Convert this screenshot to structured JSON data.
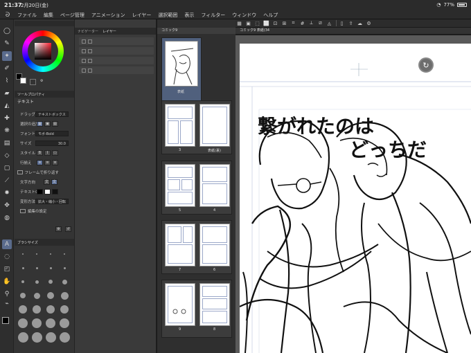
{
  "status": {
    "time": "21:37",
    "date": "2月20日(金)",
    "battery": "77%"
  },
  "menu": [
    "ファイル",
    "編集",
    "ページ管理",
    "アニメーション",
    "レイヤー",
    "選択範囲",
    "表示",
    "フィルター",
    "ウィンドウ",
    "ヘルプ"
  ],
  "left": {
    "tool_property_tab": "ツールプロパティ",
    "subtool_title": "テキスト",
    "props": [
      {
        "label": "ドラッグ",
        "value": "テキストボックス"
      },
      {
        "label": "選択の追加",
        "value": ""
      },
      {
        "label": "フォント",
        "value": "モボ-Bold"
      },
      {
        "label": "サイズ",
        "value": "30.0"
      },
      {
        "label": "スタイル",
        "value": "B  I"
      },
      {
        "label": "行揃え",
        "value": ""
      },
      {
        "label": "文字方向",
        "value": ""
      },
      {
        "label": "テキストの色",
        "value": ""
      },
      {
        "label": "変形方法",
        "value": "拡大・縮小・回転"
      }
    ],
    "frame_wrap_label": "フレームで折り返す",
    "edit_tools_label": "編集の設定",
    "brush_size_tab": "ブラシサイズ",
    "color": {
      "main": "#000000",
      "sub": "#ffffff",
      "hue": "#ff2030"
    }
  },
  "layers": {
    "tabs": [
      "ナビゲーター",
      "レイヤー"
    ]
  },
  "pages": {
    "tab": "コミック9",
    "labels": [
      "表紙",
      "3",
      "表紙(裏)",
      "5",
      "4",
      "7",
      "6",
      "9",
      "8"
    ]
  },
  "canvas": {
    "tabs": [
      "コミック9 表紙(34"
    ],
    "title_line1": "繋がれたのは",
    "title_line2": "どっちだ"
  }
}
